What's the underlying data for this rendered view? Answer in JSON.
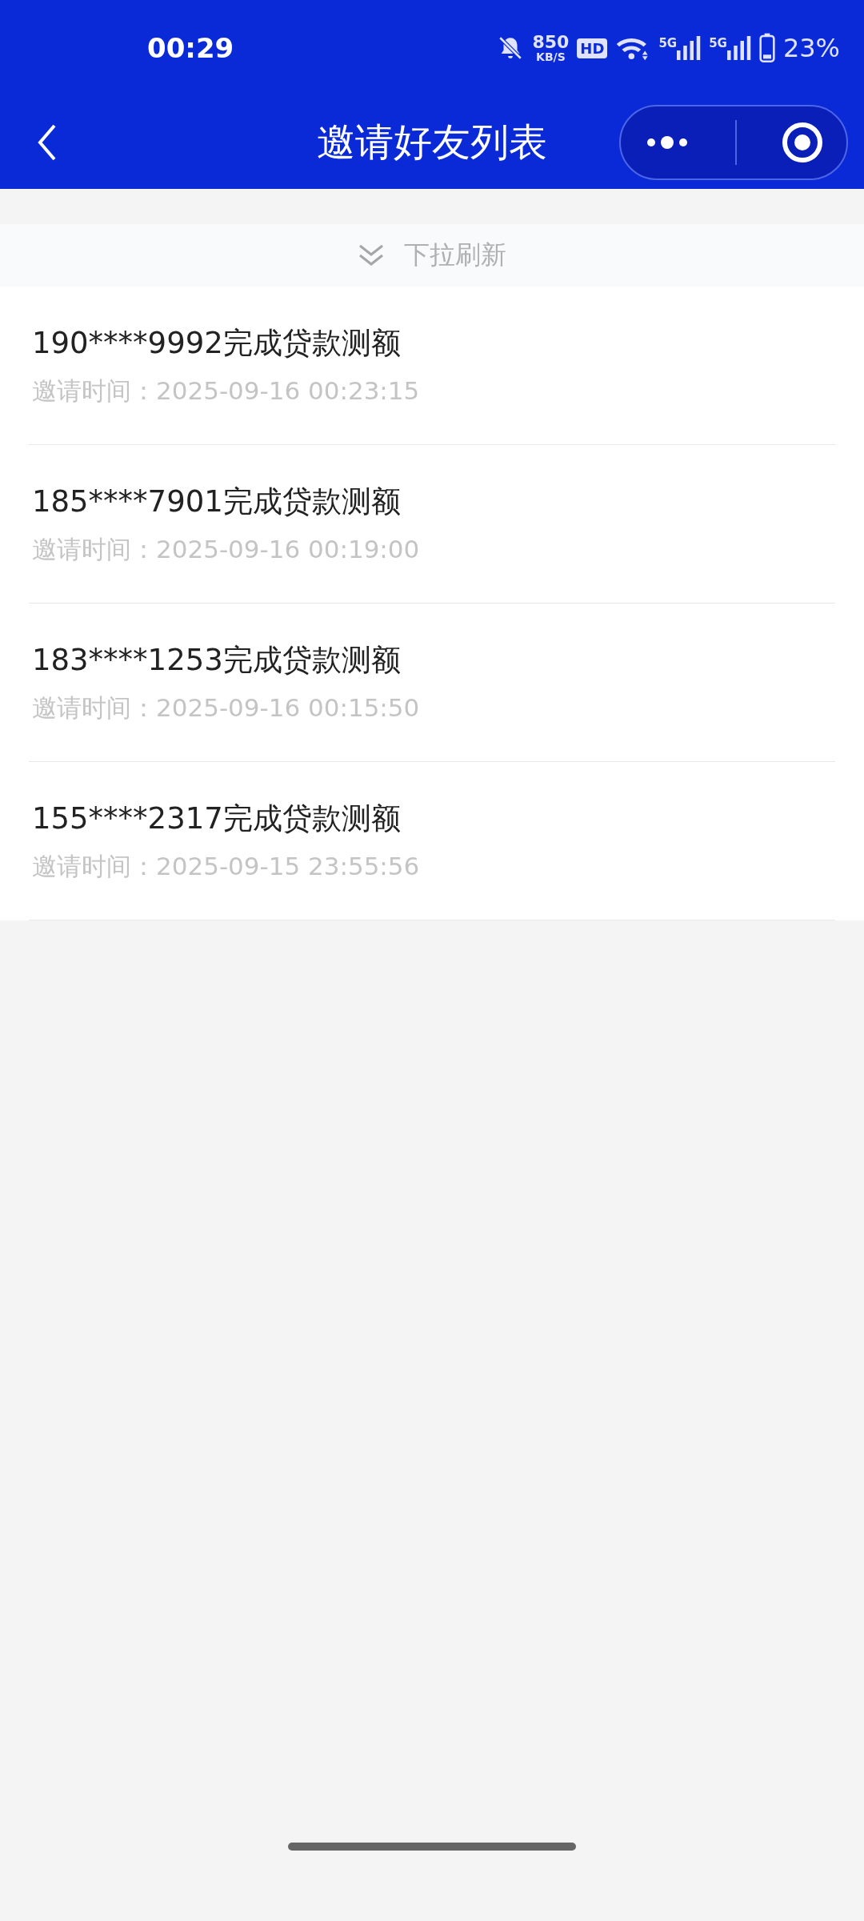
{
  "status_bar": {
    "time": "00:29",
    "speed_value": "850",
    "speed_unit": "KB/S",
    "hd": "HD",
    "signals": [
      "5G",
      "5G"
    ],
    "battery": "23%"
  },
  "nav": {
    "title": "邀请好友列表"
  },
  "pull_refresh": {
    "label": "下拉刷新"
  },
  "invites": [
    {
      "title": "190****9992完成贷款测额",
      "time": "邀请时间：2025-09-16 00:23:15"
    },
    {
      "title": "185****7901完成贷款测额",
      "time": "邀请时间：2025-09-16 00:19:00"
    },
    {
      "title": "183****1253完成贷款测额",
      "time": "邀请时间：2025-09-16 00:15:50"
    },
    {
      "title": "155****2317完成贷款测额",
      "time": "邀请时间：2025-09-15 23:55:56"
    }
  ]
}
